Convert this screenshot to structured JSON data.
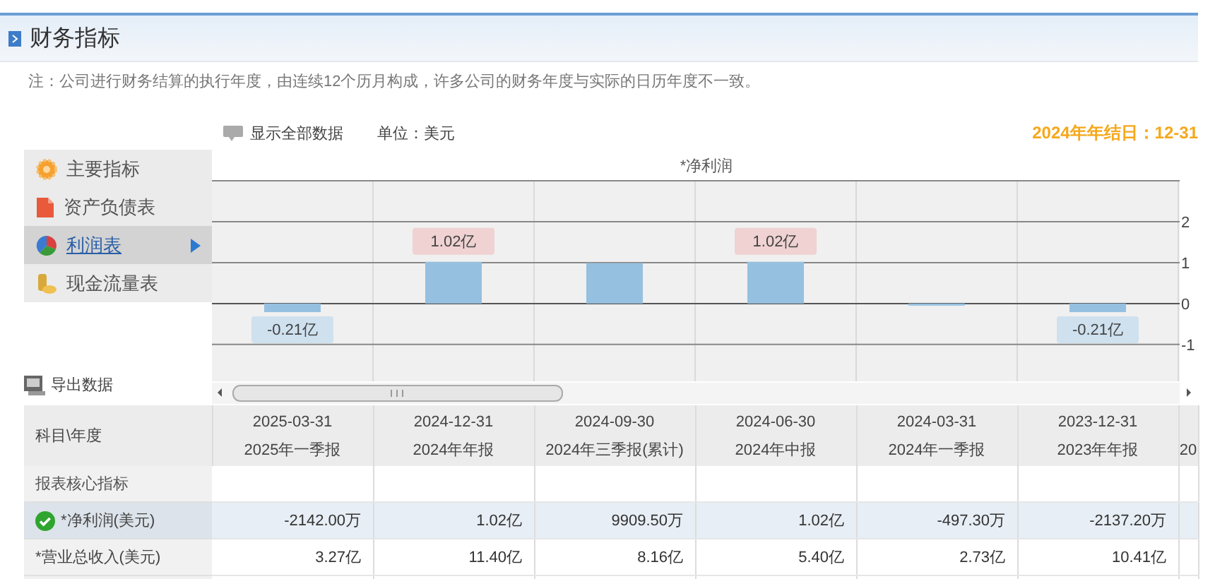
{
  "header": {
    "title": "财务指标"
  },
  "note": "注：公司进行财务结算的执行年度，由连续12个历月构成，许多公司的财务年度与实际的日历年度不一致。",
  "toolbar": {
    "show_all": "显示全部数据",
    "unit": "单位：美元",
    "fiscal_year_end": "2024年年结日：12-31"
  },
  "sidebar": {
    "items": [
      {
        "label": "主要指标",
        "kind": "gear",
        "selected": false
      },
      {
        "label": "资产负债表",
        "kind": "document",
        "selected": false
      },
      {
        "label": "利润表",
        "kind": "pie",
        "selected": true
      },
      {
        "label": "现金流量表",
        "kind": "coins",
        "selected": false
      }
    ],
    "export": "导出数据"
  },
  "chart": {
    "chart_data": {
      "type": "bar",
      "title": "*净利润",
      "values": [
        -0.21,
        1.02,
        0.99,
        1.02,
        -0.05,
        -0.21
      ],
      "ylim": [
        -1.9,
        3
      ],
      "yticks": [
        -1,
        0,
        1,
        2
      ],
      "grid": true,
      "value_labels": [
        "-0.21亿",
        "1.02亿",
        null,
        "1.02亿",
        null,
        "-0.21亿"
      ]
    }
  },
  "table": {
    "corner": "科目\\年度",
    "columns": [
      {
        "date": "2025-03-31",
        "period": "2025年一季报"
      },
      {
        "date": "2024-12-31",
        "period": "2024年年报"
      },
      {
        "date": "2024-09-30",
        "period": "2024年三季报(累计)"
      },
      {
        "date": "2024-06-30",
        "period": "2024年中报"
      },
      {
        "date": "2024-03-31",
        "period": "2024年一季报"
      },
      {
        "date": "2023-12-31",
        "period": "2023年年报"
      },
      {
        "period": "20"
      }
    ],
    "rows": [
      {
        "kind": "section",
        "label": "报表核心指标",
        "selected": false,
        "cells": []
      },
      {
        "kind": "metric",
        "label": "*净利润(美元)",
        "selected": true,
        "cells": [
          "-2142.00万",
          "1.02亿",
          "9909.50万",
          "1.02亿",
          "-497.30万",
          "-2137.20万"
        ]
      },
      {
        "kind": "metric",
        "label": "*营业总收入(美元)",
        "selected": false,
        "cells": [
          "3.27亿",
          "11.40亿",
          "8.16亿",
          "5.40亿",
          "2.73亿",
          "10.41亿"
        ]
      },
      {
        "kind": "blank",
        "selected": false,
        "cells": []
      }
    ]
  }
}
